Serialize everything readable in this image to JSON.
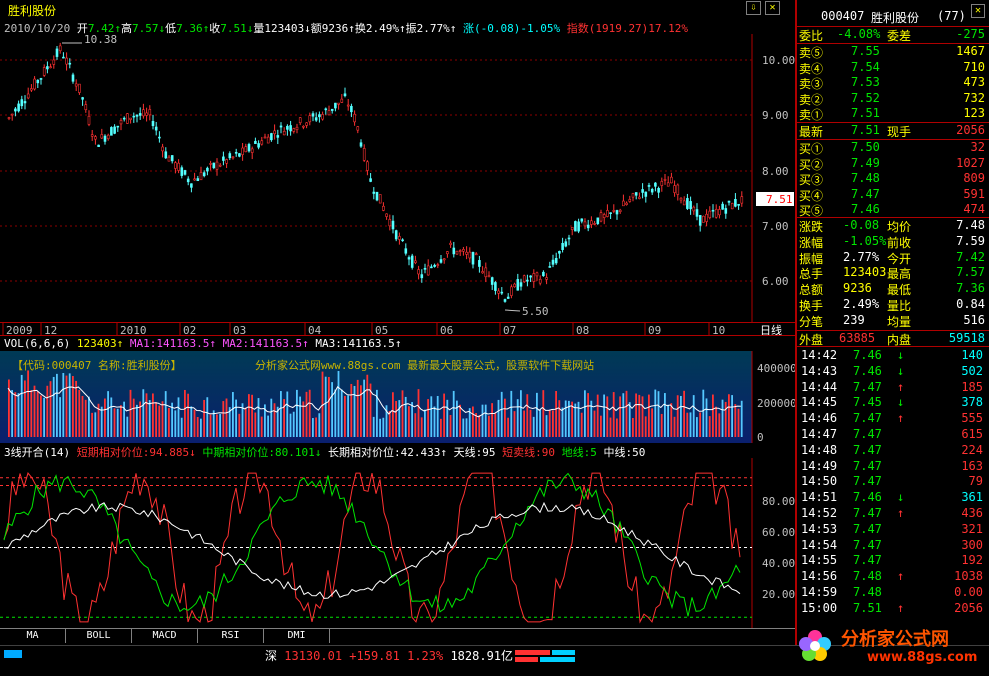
{
  "app": {
    "title": "胜利股份"
  },
  "info": {
    "date": "2010/10/20",
    "open_label": "开",
    "open": "7.42",
    "high_label": "高",
    "high": "7.57",
    "low_label": "低",
    "low": "7.36",
    "close_label": "收",
    "close": "7.51",
    "vol_label": "量",
    "vol": "123403",
    "amt_label": "额",
    "amt": "9236",
    "turn_label": "换",
    "turn": "2.49%",
    "amp_label": "振",
    "amp": "2.77%",
    "chg_label": "涨",
    "chg": "(-0.08)-1.05%",
    "index_label": "指数",
    "index": "(1919.27)17.12%"
  },
  "main": {
    "price_ticks": [
      "10.00",
      "9.00",
      "8.00",
      "7.00",
      "6.00"
    ],
    "high_marker": "10.38",
    "low_marker": "5.50",
    "current_price": "7.51"
  },
  "date_axis": {
    "labels": [
      "2009",
      "12",
      "2010",
      "02",
      "03",
      "04",
      "05",
      "06",
      "07",
      "08",
      "09",
      "10"
    ],
    "period": "日线"
  },
  "volume": {
    "header_label": "VOL(6,6,6)",
    "header_vol": "123403",
    "ma1": "MA1:141163.5",
    "ma2": "MA2:141163.5",
    "ma3": "MA3:141163.5",
    "banner_left": "【代码:000407 名称:胜利股份】",
    "banner_mid": "分析家公式网www.88gs.com 最新最大股票公式，股票软件下载网站",
    "ticks": [
      "400000",
      "200000",
      "0"
    ]
  },
  "indicator": {
    "name": "3线开合(14)",
    "short": "短期相对价位:94.885",
    "mid": "中期相对价位:80.101",
    "long": "长期相对价位:42.433",
    "sky": "天线:95",
    "sell": "短卖线:90",
    "ground": "地线:5",
    "center": "中线:50",
    "ticks": [
      "80.00",
      "60.00",
      "40.00",
      "20.00"
    ]
  },
  "tabs": [
    "MA",
    "BOLL",
    "MACD",
    "RSI",
    "DMI"
  ],
  "status": {
    "market": "深",
    "index": "13130.01",
    "change": "+159.81",
    "pct": "1.23%",
    "turnover": "1828.91亿"
  },
  "side": {
    "code": "000407",
    "name": "胜利股份",
    "count": "(77)",
    "wei_bi_label": "委比",
    "wei_bi": "-4.08%",
    "wei_cha_label": "委差",
    "wei_cha": "-275",
    "asks": [
      {
        "label": "卖⑤",
        "price": "7.55",
        "vol": "1467"
      },
      {
        "label": "卖④",
        "price": "7.54",
        "vol": "710"
      },
      {
        "label": "卖③",
        "price": "7.53",
        "vol": "473"
      },
      {
        "label": "卖②",
        "price": "7.52",
        "vol": "732"
      },
      {
        "label": "卖①",
        "price": "7.51",
        "vol": "123"
      }
    ],
    "last_label": "最新",
    "last": "7.51",
    "now_label": "现手",
    "now": "2056",
    "bids": [
      {
        "label": "买①",
        "price": "7.50",
        "vol": "32"
      },
      {
        "label": "买②",
        "price": "7.49",
        "vol": "1027"
      },
      {
        "label": "买③",
        "price": "7.48",
        "vol": "809"
      },
      {
        "label": "买④",
        "price": "7.47",
        "vol": "591"
      },
      {
        "label": "买⑤",
        "price": "7.46",
        "vol": "474"
      }
    ],
    "stats": [
      {
        "l1": "涨跌",
        "v1": "-0.08",
        "c1": "green",
        "l2": "均价",
        "v2": "7.48",
        "c2": "wht"
      },
      {
        "l1": "涨幅",
        "v1": "-1.05%",
        "c1": "green",
        "l2": "前收",
        "v2": "7.59",
        "c2": "wht"
      },
      {
        "l1": "振幅",
        "v1": "2.77%",
        "c1": "wht",
        "l2": "今开",
        "v2": "7.42",
        "c2": "green"
      },
      {
        "l1": "总手",
        "v1": "123403",
        "c1": "yel",
        "l2": "最高",
        "v2": "7.57",
        "c2": "green"
      },
      {
        "l1": "总额",
        "v1": "9236",
        "c1": "yel",
        "l2": "最低",
        "v2": "7.36",
        "c2": "green"
      },
      {
        "l1": "换手",
        "v1": "2.49%",
        "c1": "wht",
        "l2": "量比",
        "v2": "0.84",
        "c2": "wht"
      },
      {
        "l1": "分笔",
        "v1": "239",
        "c1": "wht",
        "l2": "均量",
        "v2": "516",
        "c2": "wht"
      }
    ],
    "outer_label": "外盘",
    "outer": "63885",
    "inner_label": "内盘",
    "inner": "59518",
    "ticks": [
      {
        "t": "14:42",
        "p": "7.46",
        "dir": "↓",
        "v": "140",
        "c": "green"
      },
      {
        "t": "14:43",
        "p": "7.46",
        "dir": "↓",
        "v": "502",
        "c": "green"
      },
      {
        "t": "14:44",
        "p": "7.47",
        "dir": "↑",
        "v": "185",
        "c": "red"
      },
      {
        "t": "14:45",
        "p": "7.45",
        "dir": "↓",
        "v": "378",
        "c": "green"
      },
      {
        "t": "14:46",
        "p": "7.47",
        "dir": "↑",
        "v": "555",
        "c": "red"
      },
      {
        "t": "14:47",
        "p": "7.47",
        "dir": "",
        "v": "615",
        "c": "red"
      },
      {
        "t": "14:48",
        "p": "7.47",
        "dir": "",
        "v": "224",
        "c": "red"
      },
      {
        "t": "14:49",
        "p": "7.47",
        "dir": "",
        "v": "163",
        "c": "red"
      },
      {
        "t": "14:50",
        "p": "7.47",
        "dir": "",
        "v": "79",
        "c": "red"
      },
      {
        "t": "14:51",
        "p": "7.46",
        "dir": "↓",
        "v": "361",
        "c": "green"
      },
      {
        "t": "14:52",
        "p": "7.47",
        "dir": "↑",
        "v": "436",
        "c": "red"
      },
      {
        "t": "14:53",
        "p": "7.47",
        "dir": "",
        "v": "321",
        "c": "red"
      },
      {
        "t": "14:54",
        "p": "7.47",
        "dir": "",
        "v": "300",
        "c": "red"
      },
      {
        "t": "14:55",
        "p": "7.47",
        "dir": "",
        "v": "192",
        "c": "red"
      },
      {
        "t": "14:56",
        "p": "7.48",
        "dir": "↑",
        "v": "1038",
        "c": "red"
      },
      {
        "t": "14:59",
        "p": "7.48",
        "dir": "",
        "v": "0.00",
        "c": "red"
      },
      {
        "t": "15:00",
        "p": "7.51",
        "dir": "↑",
        "v": "2056",
        "c": "red"
      }
    ]
  },
  "watermark": {
    "text": "分析家公式网",
    "url": "www.88gs.com"
  },
  "colors": {
    "up": "#ff3232",
    "down": "#54ffff",
    "ma1": "#ffffff",
    "border": "#b00000"
  }
}
